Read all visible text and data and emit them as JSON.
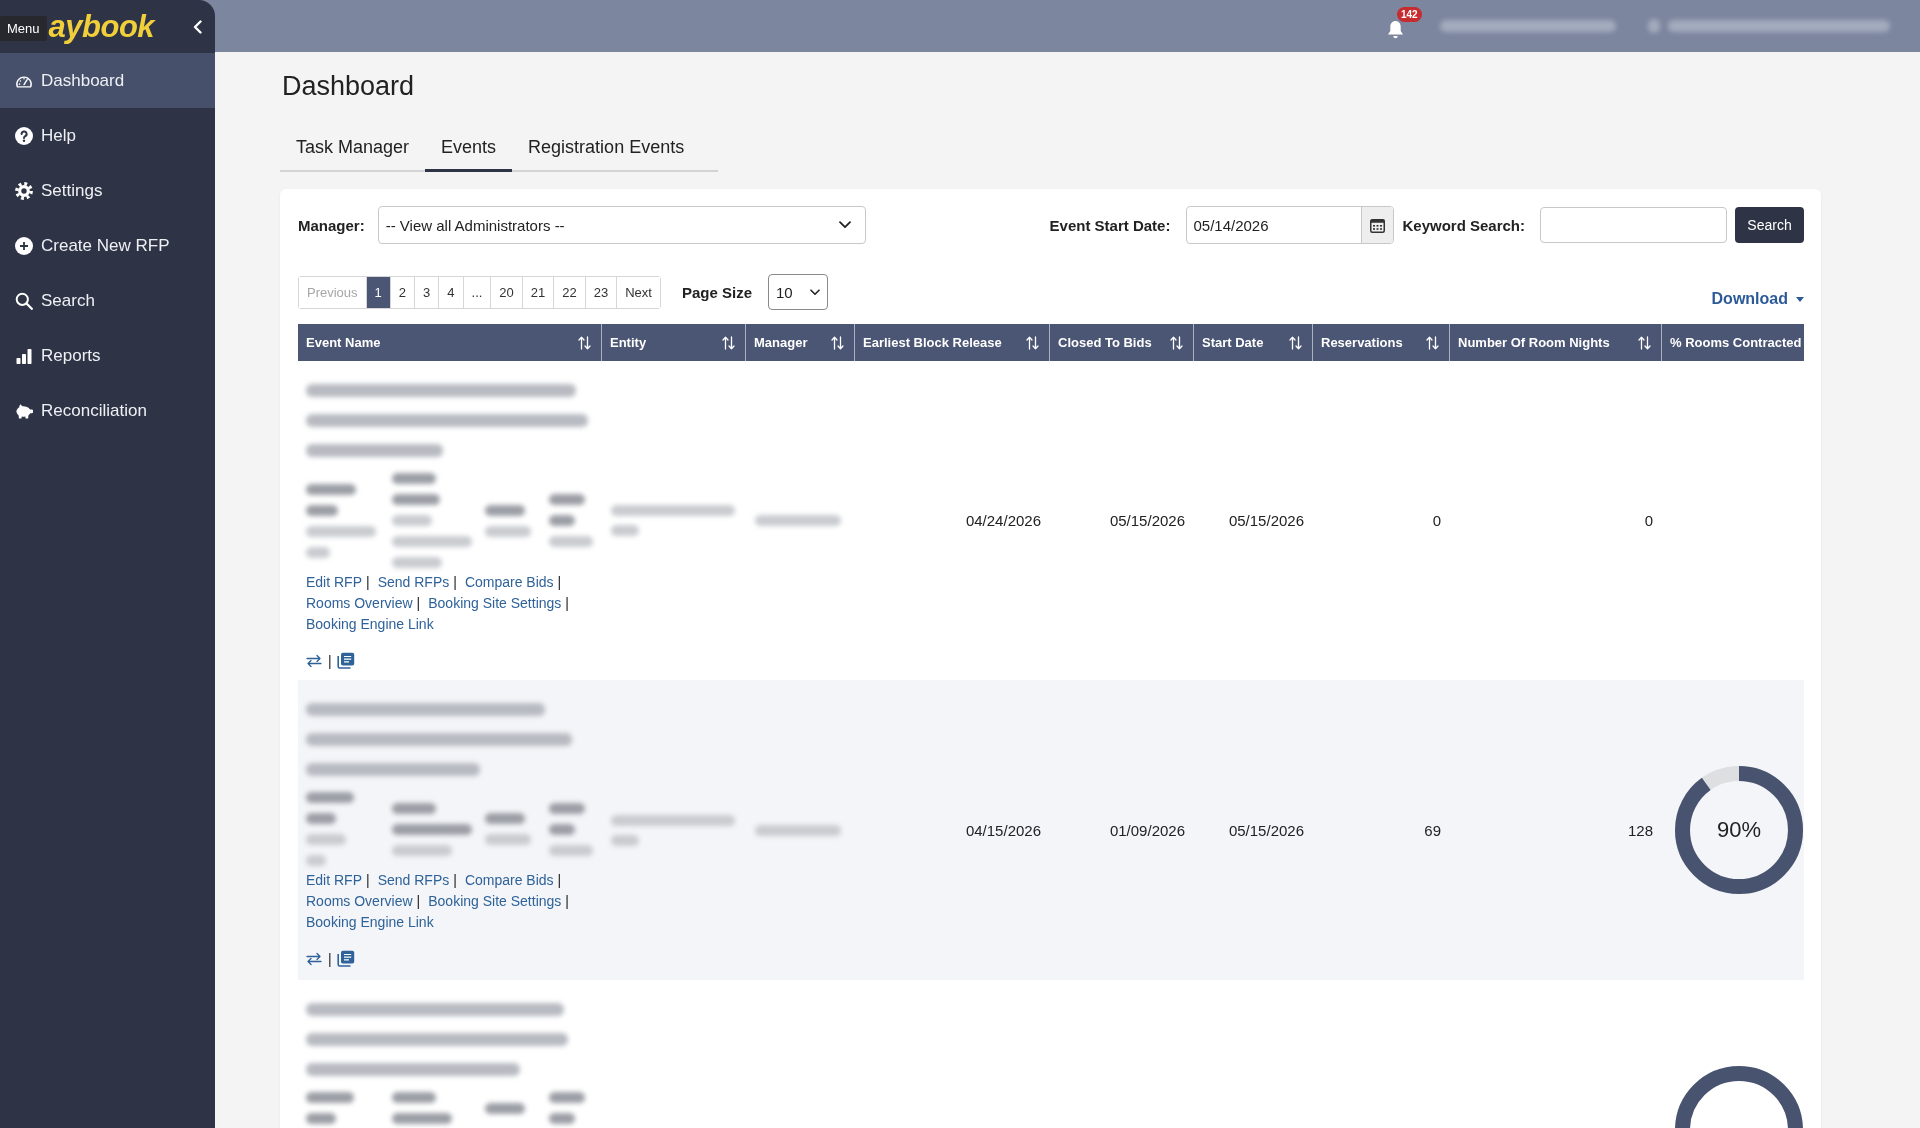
{
  "sidebar": {
    "tooltip": "Menu",
    "logo": "aybook",
    "items": [
      {
        "label": "Dashboard",
        "selected": true
      },
      {
        "label": "Help",
        "selected": false
      },
      {
        "label": "Settings",
        "selected": false
      },
      {
        "label": "Create New RFP",
        "selected": false
      },
      {
        "label": "Search",
        "selected": false
      },
      {
        "label": "Reports",
        "selected": false
      },
      {
        "label": "Reconciliation",
        "selected": false
      }
    ]
  },
  "top_bar": {
    "notification_count": "142"
  },
  "page_title": "Dashboard",
  "tabs": [
    {
      "label": "Task Manager",
      "selected": false
    },
    {
      "label": "Events",
      "selected": true
    },
    {
      "label": "Registration Events",
      "selected": false
    }
  ],
  "filters": {
    "manager": {
      "label": "Manager:",
      "value": "-- View all Administrators --"
    },
    "event_start_date": {
      "label": "Event Start Date:",
      "value": "05/14/2026"
    },
    "keyword_search": {
      "label": "Keyword Search:"
    },
    "search_button": "Search"
  },
  "pagination": {
    "pages": [
      {
        "label": "Previous",
        "selected": false,
        "disabled": true
      },
      {
        "label": "1",
        "selected": true,
        "disabled": false
      },
      {
        "label": "2",
        "selected": false,
        "disabled": false
      },
      {
        "label": "3",
        "selected": false,
        "disabled": false
      },
      {
        "label": "4",
        "selected": false,
        "disabled": false
      },
      {
        "label": "...",
        "selected": false,
        "disabled": false
      },
      {
        "label": "20",
        "selected": false,
        "disabled": false
      },
      {
        "label": "21",
        "selected": false,
        "disabled": false
      },
      {
        "label": "22",
        "selected": false,
        "disabled": false
      },
      {
        "label": "23",
        "selected": false,
        "disabled": false
      },
      {
        "label": "Next",
        "selected": false,
        "disabled": false
      }
    ],
    "page_size": {
      "label": "Page Size",
      "value": "10"
    }
  },
  "download": "Download",
  "table": {
    "columns": [
      {
        "label": "Event Name",
        "sort_icon": true
      },
      {
        "label": "Entity",
        "sort_icon": true
      },
      {
        "label": "Manager",
        "sort_icon": true
      },
      {
        "label": "Earliest Block Release",
        "sort_icon": true
      },
      {
        "label": "Closed To Bids",
        "sort_icon": true
      },
      {
        "label": "Start Date",
        "sort_icon": true
      },
      {
        "label": "Reservations",
        "sort_icon": true
      },
      {
        "label": "Number Of Room Nights",
        "sort_icon": true
      },
      {
        "label": "% Rooms Contracted",
        "sort_icon": false
      }
    ],
    "rows": [
      {
        "links": [
          "Edit RFP",
          "Send RFPs",
          "Compare Bids",
          "Rooms Overview",
          "Booking Site Settings",
          "Booking Engine Link"
        ],
        "separator": "|",
        "earliest_block_release": "04/24/2026",
        "closed_to_bids": "05/15/2026",
        "start_date": "05/15/2026",
        "reservations": "0",
        "room_nights": "0"
      },
      {
        "links": [
          "Edit RFP",
          "Send RFPs",
          "Compare Bids",
          "Rooms Overview",
          "Booking Site Settings",
          "Booking Engine Link"
        ],
        "separator": "|",
        "earliest_block_release": "04/15/2026",
        "closed_to_bids": "01/09/2026",
        "start_date": "05/15/2026",
        "reservations": "69",
        "room_nights": "128",
        "rooms_contracted": {
          "label": "90%",
          "level": 0.9
        }
      },
      {
        "rooms_contracted": {}
      }
    ]
  }
}
